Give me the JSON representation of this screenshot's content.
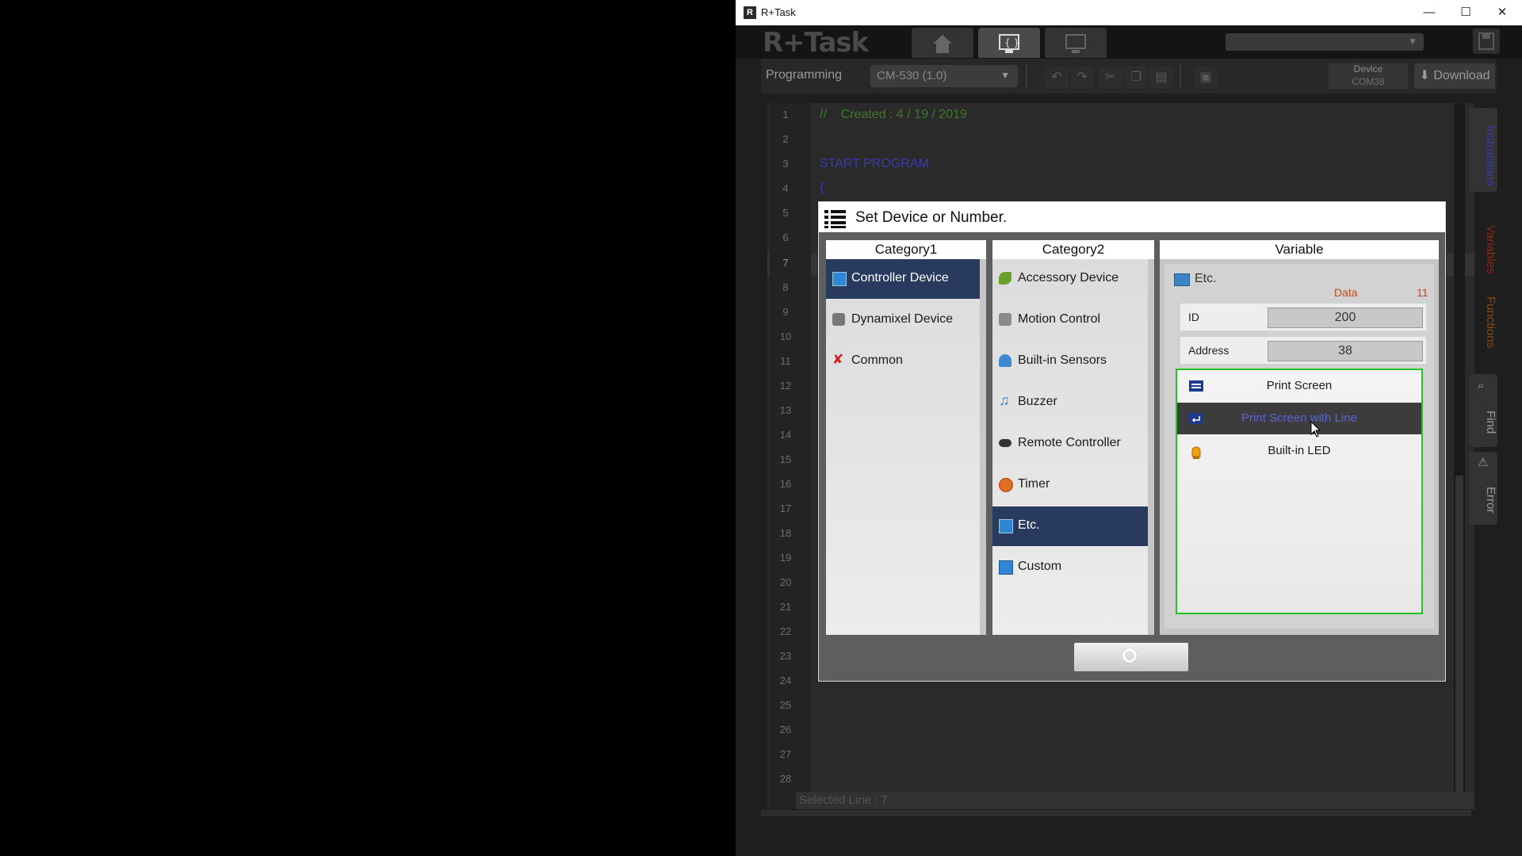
{
  "window": {
    "title": "R+Task",
    "controls": [
      "—",
      "☐",
      "✕"
    ]
  },
  "topbar": {
    "logo": "R+Task",
    "tabs": [
      "home",
      "programming",
      "monitor"
    ]
  },
  "toolbar": {
    "section_label": "Programming",
    "controller_select": "CM-530 (1.0)",
    "device_label": "Device",
    "device_port": "COM38",
    "download_label": "Download"
  },
  "editor": {
    "line_numbers": [
      "1",
      "2",
      "3",
      "4",
      "5",
      "6",
      "7",
      "8",
      "9",
      "10",
      "11",
      "12",
      "13",
      "14",
      "15",
      "16",
      "17",
      "18",
      "19",
      "20",
      "21",
      "22",
      "23",
      "24",
      "25",
      "26",
      "27",
      "28"
    ],
    "code": {
      "line1": "//    Created : 4 / 19 / 2019",
      "line3": "START PROGRAM",
      "line4": "{"
    },
    "status": "Selected Line : 7"
  },
  "side_tabs": [
    "Instructions",
    "Variables",
    "Functions",
    "Find",
    "Error"
  ],
  "dialog": {
    "title": "Set Device or Number.",
    "category1": {
      "header": "Category1",
      "items": [
        "Controller Device",
        "Dynamixel Device",
        "Common"
      ],
      "selected": "Controller Device"
    },
    "category2": {
      "header": "Category2",
      "items": [
        "Accessory Device",
        "Motion Control",
        "Built-in Sensors",
        "Buzzer",
        "Remote Controller",
        "Timer",
        "Etc.",
        "Custom"
      ],
      "selected": "Etc."
    },
    "variable": {
      "header": "Variable",
      "group": "Etc.",
      "data_label": "Data",
      "data_value": "11",
      "id_label": "ID",
      "id_value": "200",
      "address_label": "Address",
      "address_value": "38",
      "items": [
        "Print Screen",
        "Print Screen with Line",
        "Built-in LED"
      ],
      "selected": "Print Screen with Line"
    },
    "ok_symbol": "○"
  },
  "colors": {
    "selected_bg": "#283b5e",
    "list_border": "#22c42a",
    "data_accent": "#c24a14",
    "code_comment": "#3f7a2a",
    "code_keyword": "#3b3bb0"
  }
}
